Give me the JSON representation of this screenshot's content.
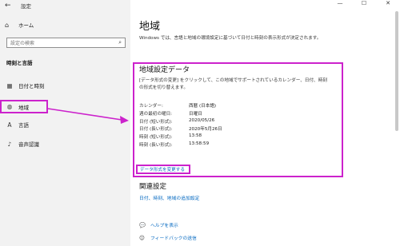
{
  "window": {
    "app_title": "設定",
    "back_glyph": "←",
    "minimize_glyph": "—",
    "maximize_glyph": "☐",
    "close_glyph": "✕"
  },
  "sidebar": {
    "home_icon": "home-icon",
    "home_label": "ホーム",
    "search_placeholder": "設定の検索",
    "section_heading": "時刻と言語",
    "items": [
      {
        "icon": "calendar-icon",
        "label": "日付と時刻"
      },
      {
        "icon": "globe-icon",
        "label": "地域"
      },
      {
        "icon": "language-icon",
        "label": "言語"
      },
      {
        "icon": "microphone-icon",
        "label": "音声認識"
      }
    ]
  },
  "main": {
    "title": "地域",
    "intro": "Windows では、言語と地域の環境設定に基づいて日付と時刻の表示形式が決定されます。",
    "region_format": {
      "heading": "地域設定データ",
      "description": "[データ形式の変更] をクリックして、この地域でサポートされているカレンダー、日付、時刻の形式を切り替えます。",
      "rows": [
        {
          "key": "カレンダー:",
          "value": "西暦 (日本語)"
        },
        {
          "key": "週の最初の曜日:",
          "value": "日曜日"
        },
        {
          "key": "日付 (短い形式):",
          "value": "2020/05/26"
        },
        {
          "key": "日付 (長い形式):",
          "value": "2020年5月26日"
        },
        {
          "key": "時刻 (短い形式):",
          "value": "13:58"
        },
        {
          "key": "時刻 (長い形式):",
          "value": "13:58:59"
        }
      ],
      "change_button": "データ形式を変更する"
    },
    "related": {
      "heading": "関連設定",
      "link": "日付、時刻、地域の追加設定"
    },
    "help": [
      {
        "icon": "help-icon",
        "label": "ヘルプを表示"
      },
      {
        "icon": "feedback-icon",
        "label": "フィードバックの送信"
      }
    ]
  },
  "colors": {
    "highlight": "#cc22cc",
    "link": "#0067c0",
    "sidebar_bg": "#f2f2f2"
  }
}
